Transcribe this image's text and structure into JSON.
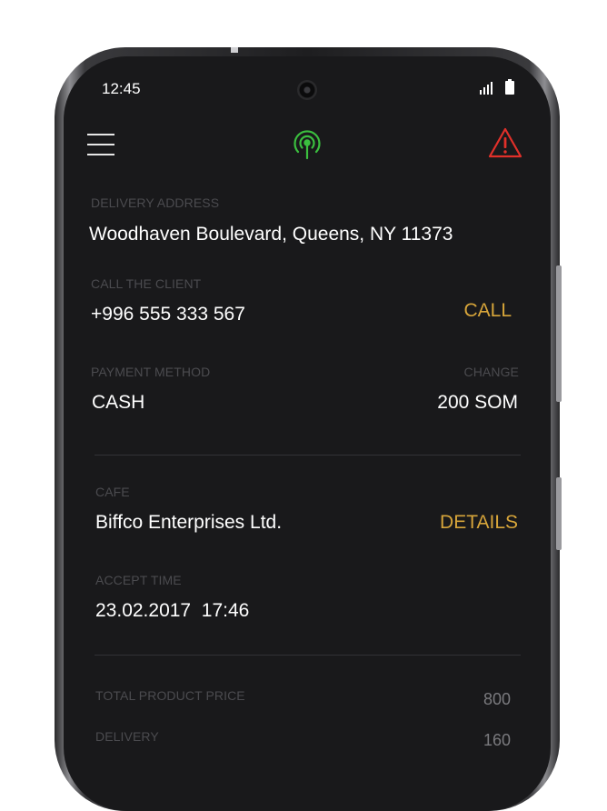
{
  "status_bar": {
    "time": "12:45"
  },
  "delivery": {
    "label": "DELIVERY ADDRESS",
    "address": "Woodhaven Boulevard, Queens, NY 11373"
  },
  "client": {
    "label": "CALL THE CLIENT",
    "phone": "+996 555 333 567",
    "call_label": "CALL"
  },
  "payment": {
    "label": "PAYMENT METHOD",
    "change_label": "CHANGE",
    "method": "CASH",
    "amount": "200 SOM"
  },
  "cafe": {
    "label": "CAFE",
    "name": "Biffco Enterprises Ltd.",
    "details_label": "DETAILS"
  },
  "accept": {
    "label": "ACCEPT TIME",
    "value": "23.02.2017  17:46"
  },
  "totals": {
    "product_label": "TOTAL PRODUCT PRICE",
    "product_value": "800",
    "delivery_label": "DELIVERY",
    "delivery_value": "160"
  },
  "colors": {
    "accent": "#d7a53a",
    "signal_green": "#3bbf3f",
    "warning_red": "#e0302a",
    "background": "#19191b"
  }
}
